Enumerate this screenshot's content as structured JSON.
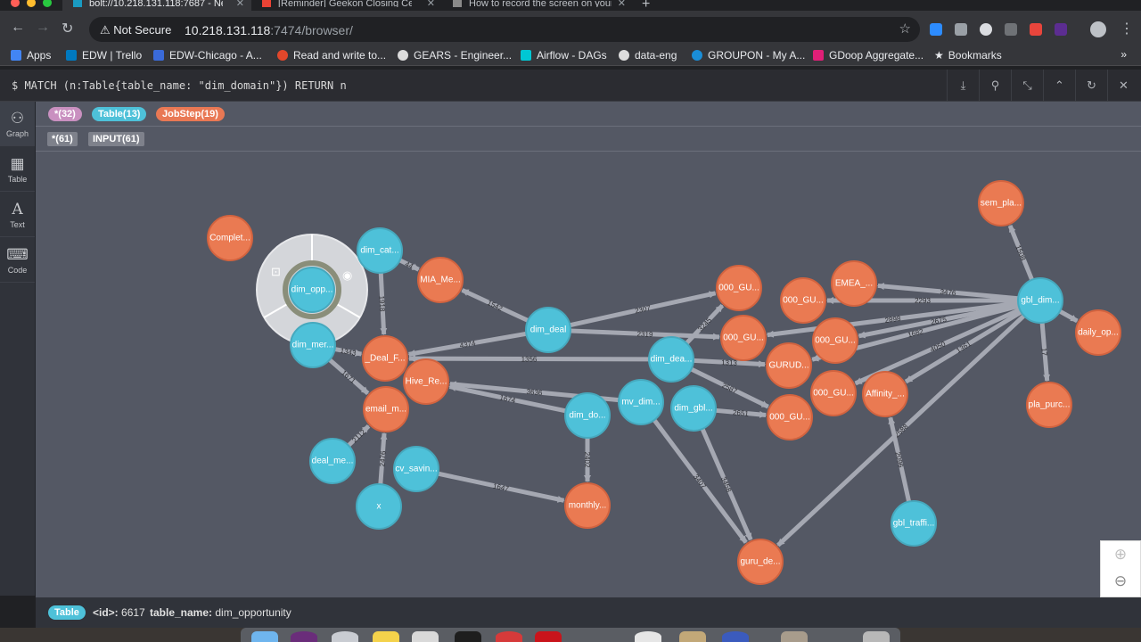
{
  "tabs": [
    {
      "label": "bolt://10.218.131.118:7687 - Neo4j Browser",
      "active": true
    },
    {
      "label": "[Reminder] Geekon Closing Ceremony",
      "active": false
    },
    {
      "label": "How to record the screen on your Mac",
      "active": false
    }
  ],
  "toolbar": {
    "security": "Not Secure",
    "url_host": "10.218.131.118",
    "url_path": ":7474/browser/"
  },
  "bookmarks": [
    {
      "label": "Apps",
      "color": "#4285f4"
    },
    {
      "label": "EDW | Trello",
      "color": "#0079bf"
    },
    {
      "label": "EDW-Chicago - A...",
      "color": "#3a6ad9"
    },
    {
      "label": "Read and write to...",
      "color": "#e2472b"
    },
    {
      "label": "GEARS - Engineer...",
      "color": "#dcdcdc"
    },
    {
      "label": "Airflow - DAGs",
      "color": "#00c7d4"
    },
    {
      "label": "data-eng",
      "color": "#dcdcdc"
    },
    {
      "label": "GROUPON - My A...",
      "color": "#1a8ed8"
    },
    {
      "label": "GDoop Aggregate...",
      "color": "#e01f77"
    },
    {
      "label": "Bookmarks",
      "color": "#dcdcdc"
    }
  ],
  "editor": {
    "query": "$ MATCH (n:Table{table_name: \"dim_domain\"}) RETURN n"
  },
  "sidebar": [
    {
      "label": "Graph",
      "icon": "graph-icon"
    },
    {
      "label": "Table",
      "icon": "table-icon"
    },
    {
      "label": "Text",
      "icon": "text-icon"
    },
    {
      "label": "Code",
      "icon": "code-icon"
    }
  ],
  "legend": {
    "labels": [
      {
        "text": "*(32)",
        "color": "#c990c0"
      },
      {
        "text": "Table(13)",
        "color": "#4ec1d9"
      },
      {
        "text": "JobStep(19)",
        "color": "#e97854"
      }
    ],
    "rels": [
      {
        "text": "*(61)"
      },
      {
        "text": "INPUT(61)"
      }
    ]
  },
  "colors": {
    "table": "#4ec1d9",
    "jobstep": "#ea7a52",
    "edge": "#a5a8b2",
    "canvas": "#545864"
  },
  "graph": {
    "nodes": [
      {
        "id": "n1",
        "label": "Complet...",
        "type": "jobstep"
      },
      {
        "id": "n2",
        "label": "dim_cat...",
        "type": "table"
      },
      {
        "id": "n3",
        "label": "dim_opp...",
        "type": "table"
      },
      {
        "id": "n4",
        "label": "MIA_Me...",
        "type": "jobstep"
      },
      {
        "id": "n5",
        "label": "dim_mer...",
        "type": "table"
      },
      {
        "id": "n6",
        "label": "_Deal_F...",
        "type": "jobstep"
      },
      {
        "id": "n7",
        "label": "Hive_Re...",
        "type": "jobstep"
      },
      {
        "id": "n8",
        "label": "email_m...",
        "type": "jobstep"
      },
      {
        "id": "n9",
        "label": "deal_me...",
        "type": "table"
      },
      {
        "id": "n10",
        "label": "x",
        "type": "table"
      },
      {
        "id": "n11",
        "label": "cv_savin...",
        "type": "table"
      },
      {
        "id": "n12",
        "label": "dim_deal",
        "type": "table"
      },
      {
        "id": "n13",
        "label": "dim_do...",
        "type": "table"
      },
      {
        "id": "n14",
        "label": "monthly...",
        "type": "jobstep"
      },
      {
        "id": "n15",
        "label": "dim_dea...",
        "type": "table"
      },
      {
        "id": "n16",
        "label": "mv_dim...",
        "type": "table"
      },
      {
        "id": "n17",
        "label": "dim_gbl...",
        "type": "table"
      },
      {
        "id": "n18",
        "label": "000_GU...",
        "type": "jobstep"
      },
      {
        "id": "n19",
        "label": "000_GU...",
        "type": "jobstep"
      },
      {
        "id": "n20",
        "label": "000_GU...",
        "type": "jobstep"
      },
      {
        "id": "n21",
        "label": "EMEA_...",
        "type": "jobstep"
      },
      {
        "id": "n22",
        "label": "000_GU...",
        "type": "jobstep"
      },
      {
        "id": "n23",
        "label": "GURUD...",
        "type": "jobstep"
      },
      {
        "id": "n24",
        "label": "000_GU...",
        "type": "jobstep"
      },
      {
        "id": "n25",
        "label": "000_GU...",
        "type": "jobstep"
      },
      {
        "id": "n26",
        "label": "Affinity_...",
        "type": "jobstep"
      },
      {
        "id": "n27",
        "label": "gbl_dim...",
        "type": "table"
      },
      {
        "id": "n28",
        "label": "sem_pla...",
        "type": "jobstep"
      },
      {
        "id": "n29",
        "label": "daily_op...",
        "type": "jobstep"
      },
      {
        "id": "n30",
        "label": "pla_purc...",
        "type": "jobstep"
      },
      {
        "id": "n31",
        "label": "gbl_traffi...",
        "type": "table"
      },
      {
        "id": "n32",
        "label": "guru_de...",
        "type": "jobstep"
      }
    ],
    "edges": [
      {
        "from": "n2",
        "to": "n6",
        "label": "1918"
      },
      {
        "from": "n2",
        "to": "n4",
        "label": "44"
      },
      {
        "from": "n5",
        "to": "n6",
        "label": "1343"
      },
      {
        "from": "n5",
        "to": "n8",
        "label": "1671"
      },
      {
        "from": "n9",
        "to": "n8",
        "label": "2112"
      },
      {
        "from": "n10",
        "to": "n8",
        "label": "2476"
      },
      {
        "from": "n11",
        "to": "n14",
        "label": "1647"
      },
      {
        "from": "n12",
        "to": "n4",
        "label": "1542"
      },
      {
        "from": "n12",
        "to": "n6",
        "label": "4374"
      },
      {
        "from": "n12",
        "to": "n18",
        "label": "2307"
      },
      {
        "from": "n12",
        "to": "n20",
        "label": "2319"
      },
      {
        "from": "n13",
        "to": "n14",
        "label": "2402"
      },
      {
        "from": "n13",
        "to": "n7",
        "label": "1674"
      },
      {
        "from": "n15",
        "to": "n6",
        "label": "1356"
      },
      {
        "from": "n15",
        "to": "n18",
        "label": "3245"
      },
      {
        "from": "n15",
        "to": "n23",
        "label": "1313"
      },
      {
        "from": "n16",
        "to": "n7",
        "label": "3636"
      },
      {
        "from": "n16",
        "to": "n32",
        "label": "3407"
      },
      {
        "from": "n17",
        "to": "n32",
        "label": "3458"
      },
      {
        "from": "n17",
        "to": "n24",
        "label": "2651"
      },
      {
        "from": "n27",
        "to": "n21",
        "label": "3476"
      },
      {
        "from": "n27",
        "to": "n19",
        "label": "2293"
      },
      {
        "from": "n27",
        "to": "n22",
        "label": "2675"
      },
      {
        "from": "n27",
        "to": "n20",
        "label": "2898"
      },
      {
        "from": "n27",
        "to": "n26",
        "label": "1361"
      },
      {
        "from": "n27",
        "to": "n28",
        "label": "1508"
      },
      {
        "from": "n27",
        "to": "n30",
        "label": "17"
      },
      {
        "from": "n27",
        "to": "n29",
        "label": ""
      },
      {
        "from": "n27",
        "to": "n25",
        "label": "4050"
      },
      {
        "from": "n27",
        "to": "n32",
        "label": "2588"
      },
      {
        "from": "n31",
        "to": "n26",
        "label": "2096"
      },
      {
        "from": "n27",
        "to": "n23",
        "label": "1682"
      },
      {
        "from": "n15",
        "to": "n24",
        "label": "2587"
      }
    ]
  },
  "status": {
    "label": "Table",
    "id_key": "<id>:",
    "id_value": "6617",
    "name_key": "table_name:",
    "name_value": "dim_opportunity"
  },
  "zoom": {
    "in": "zoom-in-icon",
    "out": "zoom-out-icon"
  }
}
